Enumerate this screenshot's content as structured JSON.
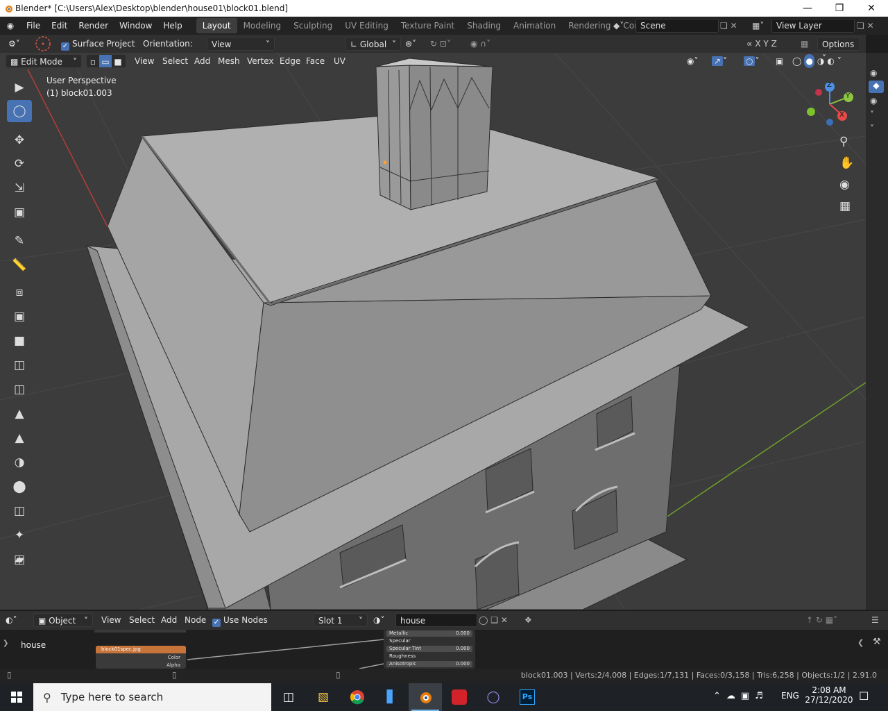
{
  "window": {
    "title": "Blender* [C:\\Users\\Alex\\Desktop\\blender\\house01\\block01.blend]"
  },
  "menu": [
    "File",
    "Edit",
    "Render",
    "Window",
    "Help"
  ],
  "workspaces": [
    "Layout",
    "Modeling",
    "Sculpting",
    "UV Editing",
    "Texture Paint",
    "Shading",
    "Animation",
    "Rendering",
    "Compositing"
  ],
  "scene": {
    "name": "Scene",
    "view_layer": "View Layer"
  },
  "tool_header": {
    "surface_project": "Surface Project",
    "orientation_label": "Orientation:",
    "orientation_value": "View",
    "transform_orientation": "Global",
    "options": "Options"
  },
  "edit_header": {
    "mode": "Edit Mode",
    "menus": [
      "View",
      "Select",
      "Add",
      "Mesh",
      "Vertex",
      "Edge",
      "Face",
      "UV"
    ]
  },
  "viewport": {
    "perspective": "User Perspective",
    "object": "(1) block01.003"
  },
  "gizmo": {
    "x": "X",
    "y": "Y",
    "z": "Z"
  },
  "node_header": {
    "object": "Object",
    "menus": [
      "View",
      "Select",
      "Add",
      "Node"
    ],
    "use_nodes": "Use Nodes",
    "slot": "Slot 1",
    "material": "house"
  },
  "node_editor": {
    "material_label": "house",
    "image_node_title": "block01spec.jpg",
    "image_outputs": [
      "Color",
      "Alpha"
    ],
    "bsdf_rows": [
      {
        "label": "Metallic",
        "value": "0.000"
      },
      {
        "label": "Specular",
        "value": ""
      },
      {
        "label": "Specular Tint",
        "value": "0.000"
      },
      {
        "label": "Roughness",
        "value": ""
      },
      {
        "label": "Anisotropic",
        "value": "0.000"
      }
    ]
  },
  "status": {
    "text": "block01.003 | Verts:2/4,008 | Edges:1/7,131 | Faces:0/3,158 | Tris:6,258 | Objects:1/2 | 2.91.0"
  },
  "taskbar": {
    "search_placeholder": "Type here to search",
    "lang": "ENG",
    "time": "2:08 AM",
    "date": "27/12/2020"
  },
  "colors": {
    "accent": "#4772b3",
    "x_axis": "#e64a4a",
    "y_axis": "#8dc640",
    "z_axis": "#4d8fe0",
    "image_node": "#c6743a"
  }
}
